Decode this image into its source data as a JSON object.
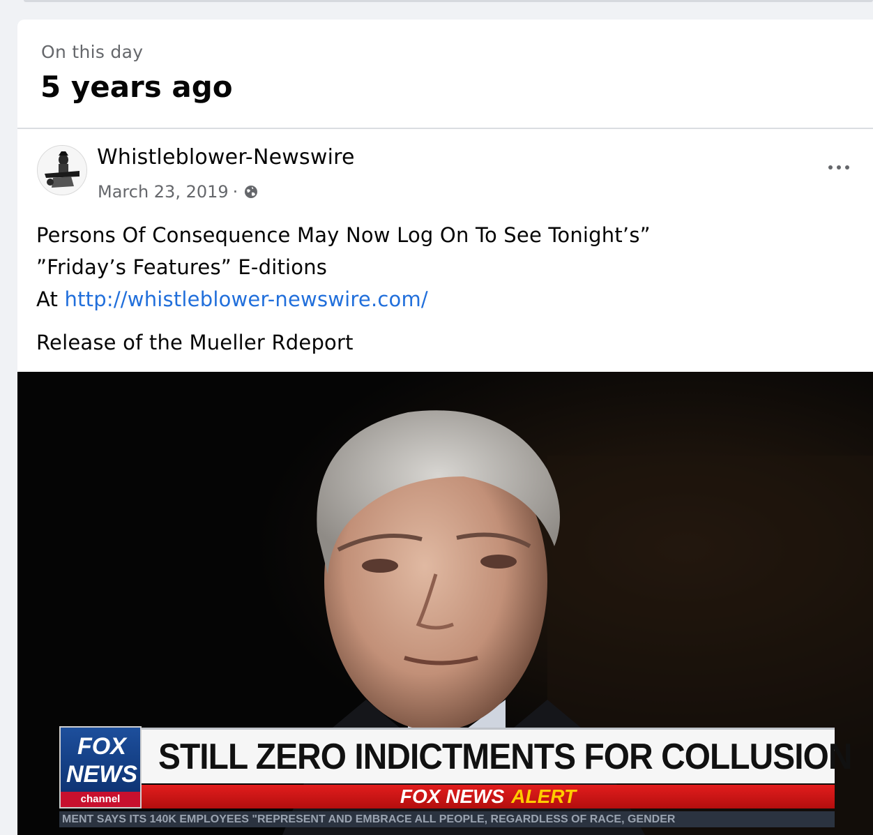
{
  "memory": {
    "subtitle": "On this day",
    "title": "5 years ago"
  },
  "post": {
    "page_name": "Whistleblower-Newswire",
    "date": "March 23, 2019",
    "separator": "·",
    "audience_icon": "globe-icon",
    "more_icon": "more-options-icon",
    "text_line1": "Persons Of Consequence May Now Log On To See Tonight’s”",
    "text_line2": "”Friday’s Features” E-ditions",
    "text_line3_prefix": "At ",
    "link_text": "http://whistleblower-newswire.com/",
    "text_para2": "Release of the Mueller Rdeport"
  },
  "image": {
    "logo_line1": "FOX",
    "logo_line2": "NEWS",
    "logo_line3": "channel",
    "headline": "STILL ZERO INDICTMENTS FOR COLLUSION",
    "alert_part1": "FOX NEWS",
    "alert_part2": "ALERT",
    "ticker": "MENT SAYS ITS 140K EMPLOYEES \"REPRESENT AND EMBRACE ALL PEOPLE, REGARDLESS OF RACE, GENDER"
  },
  "colors": {
    "link": "#216fdb",
    "text": "#050505",
    "secondary_text": "#65676b",
    "background": "#f0f2f5"
  }
}
